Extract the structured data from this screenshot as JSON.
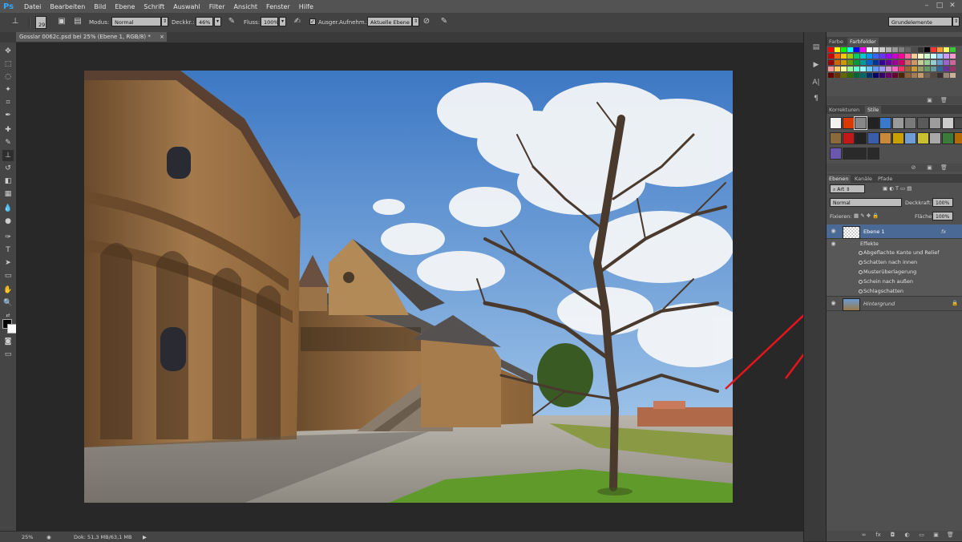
{
  "app": {
    "logo": "Ps"
  },
  "menu": [
    "Datei",
    "Bearbeiten",
    "Bild",
    "Ebene",
    "Schrift",
    "Auswahl",
    "Filter",
    "Ansicht",
    "Fenster",
    "Hilfe"
  ],
  "options": {
    "brush_size": "29",
    "mode_label": "Modus:",
    "mode_value": "Normal",
    "opacity_label": "Deckkr.:",
    "opacity_value": "46%",
    "flow_label": "Fluss:",
    "flow_value": "100%",
    "aligned_label": "Ausger.",
    "sample_label": "Aufnehm.:",
    "sample_value": "Aktuelle Ebene",
    "workspace": "Grundelemente"
  },
  "document": {
    "tab_title": "Gosslar 0062c.psd bei 25% (Ebene 1, RGB/8) *"
  },
  "status": {
    "zoom": "25%",
    "doc_info": "Dok: 51,3 MB/63,1 MB"
  },
  "swatches_panel": {
    "tabs": [
      "Farbe",
      "Farbfelder"
    ],
    "active_tab": "Farbfelder",
    "rows": [
      [
        "#ff0000",
        "#ffff00",
        "#00ff00",
        "#00ffff",
        "#0000ff",
        "#ff00ff",
        "#ffffff",
        "#e6e6e6",
        "#cccccc",
        "#b3b3b3",
        "#999999",
        "#808080",
        "#666666",
        "#4d4d4d",
        "#333333",
        "#000000",
        "#ff3333",
        "#ff9933",
        "#ffff66",
        "#33cc33"
      ],
      [
        "#cc0000",
        "#ff6600",
        "#ffcc00",
        "#99cc00",
        "#00cc66",
        "#00cccc",
        "#0099ff",
        "#3366ff",
        "#6633ff",
        "#9900ff",
        "#cc00cc",
        "#ff0099",
        "#ff6699",
        "#ffcc99",
        "#ffffcc",
        "#ccffcc",
        "#ccffff",
        "#99ccff",
        "#cc99ff",
        "#ff99cc"
      ],
      [
        "#990000",
        "#cc6600",
        "#cc9900",
        "#669900",
        "#009933",
        "#009999",
        "#0066cc",
        "#003399",
        "#330099",
        "#660099",
        "#990099",
        "#cc0066",
        "#cc6666",
        "#cc9966",
        "#cccc99",
        "#99cc99",
        "#99cccc",
        "#6699cc",
        "#9966cc",
        "#cc6699"
      ],
      [
        "#ff9999",
        "#ffcc66",
        "#ffff99",
        "#99ff99",
        "#66ffcc",
        "#99ffff",
        "#66ccff",
        "#6699ff",
        "#9999ff",
        "#cc99cc",
        "#ff66cc",
        "#ff3366",
        "#996633",
        "#cc9933",
        "#999966",
        "#669966",
        "#669999",
        "#336699",
        "#663399",
        "#993366"
      ],
      [
        "#660000",
        "#663300",
        "#666600",
        "#336600",
        "#006633",
        "#006666",
        "#003366",
        "#000066",
        "#330066",
        "#660066",
        "#660033",
        "#4d2600",
        "#8c6239",
        "#a67c52",
        "#c69c6d",
        "#736357",
        "#534741",
        "#362f2d",
        "#998675",
        "#c7b299"
      ]
    ]
  },
  "styles_panel": {
    "tabs": [
      "Korrekturen",
      "Stile"
    ],
    "active_tab": "Stile",
    "row1": [
      "#f2f2f2",
      "#d93a00",
      "#888888",
      "#222222",
      "#3a78c9",
      "#9a9a9a",
      "#7a7a7a",
      "#5a5a5a",
      "#9d9d9d",
      "#cccccc",
      "#4a4a4a"
    ],
    "row2": [
      "#8a6a3a",
      "#c21818",
      "#222222",
      "#3a5dab",
      "#c88a3a",
      "#c8a000",
      "#6e9dd6",
      "#c8c030",
      "#a8a8a8",
      "#3a7a3a",
      "#b36a00"
    ],
    "row3": [
      "#6a58b0",
      "#2a2a2a",
      "#2a2a2a",
      "#2a2a2a"
    ]
  },
  "layers_panel": {
    "tabs": [
      "Ebenen",
      "Kanäle",
      "Pfade"
    ],
    "active_tab": "Ebenen",
    "filter": "Art",
    "blend_mode": "Normal",
    "opacity_label": "Deckkraft:",
    "opacity_value": "100%",
    "fill_label": "Fläche:",
    "fill_value": "100%",
    "lock_label": "Fixieren:",
    "layers": [
      {
        "name": "Ebene 1",
        "fx": "fx",
        "effects_label": "Effekte",
        "effects": [
          "Abgeflachte Kante und Relief",
          "Schatten nach innen",
          "Musterüberlagerung",
          "Schein nach außen",
          "Schlagschatten"
        ]
      },
      {
        "name": "Hintergrund"
      }
    ]
  },
  "colors": {
    "accent": "#31a8ff",
    "arrow_red": "#e8141c"
  }
}
